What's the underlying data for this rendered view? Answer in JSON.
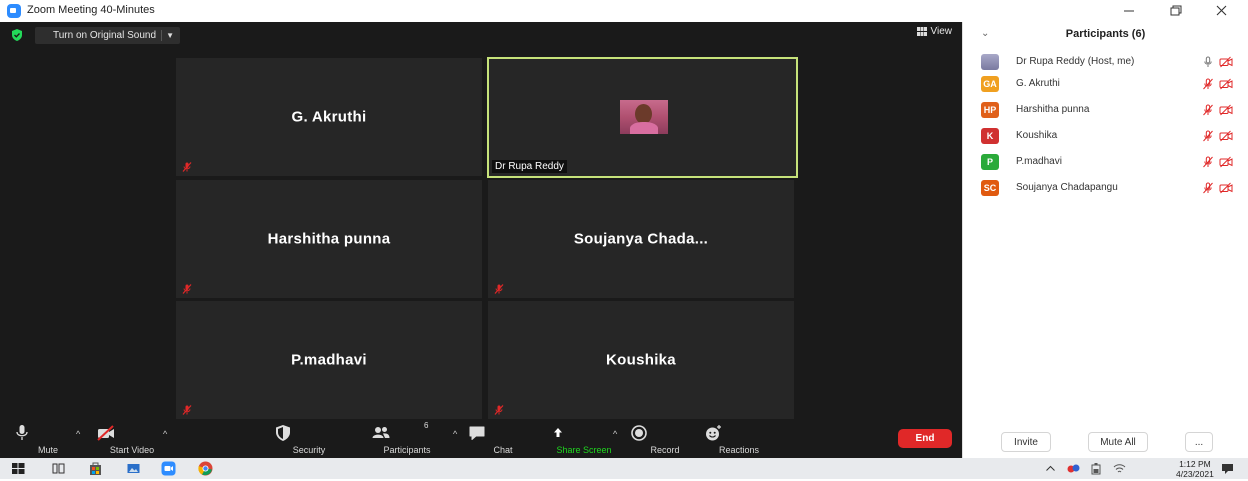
{
  "window": {
    "title": "Zoom Meeting 40-Minutes",
    "controls": [
      "minimize-icon",
      "restore-icon",
      "close-icon"
    ]
  },
  "meeting": {
    "original_sound_label": "Turn on Original Sound",
    "view_label": "View",
    "tiles": [
      {
        "name": "G. Akruthi",
        "muted": true
      },
      {
        "name": "Dr Rupa Reddy",
        "is_video": true,
        "active_speaker": true
      },
      {
        "name": "Harshitha punna",
        "muted": true
      },
      {
        "name": "Soujanya  Chada...",
        "muted": true
      },
      {
        "name": "P.madhavi",
        "muted": true
      },
      {
        "name": "Koushika",
        "muted": true
      }
    ]
  },
  "toolbar": {
    "mute": "Mute",
    "start_video": "Start Video",
    "security": "Security",
    "participants": "Participants",
    "participant_count": "6",
    "chat": "Chat",
    "share_screen": "Share Screen",
    "record": "Record",
    "reactions": "Reactions",
    "end": "End"
  },
  "panel": {
    "title": "Participants (6)",
    "participants": [
      {
        "name": "Dr Rupa Reddy (Host, me)",
        "avatar": "photo",
        "color": "#8a8ab0",
        "mic": "on",
        "video": "off"
      },
      {
        "name": "G. Akruthi",
        "avatar": "GA",
        "color": "#f0a020",
        "mic": "muted",
        "video": "off"
      },
      {
        "name": "Harshitha punna",
        "avatar": "HP",
        "color": "#e0601a",
        "mic": "muted",
        "video": "off"
      },
      {
        "name": "Koushika",
        "avatar": "K",
        "color": "#d03030",
        "mic": "muted",
        "video": "off"
      },
      {
        "name": "P.madhavi",
        "avatar": "P",
        "color": "#2aaa3a",
        "mic": "muted",
        "video": "off"
      },
      {
        "name": "Soujanya Chadapangu",
        "avatar": "SC",
        "color": "#e05a10",
        "mic": "muted",
        "video": "off"
      }
    ],
    "invite": "Invite",
    "mute_all": "Mute All",
    "more": "..."
  },
  "taskbar": {
    "time": "1:12 PM",
    "date": "4/23/2021"
  },
  "colors": {
    "meeting_bg": "#1a1a1a",
    "tile_bg": "#262626",
    "active_border": "#c6e27a",
    "share_green": "#1fb41f",
    "end_red": "#e02828",
    "muted_red": "#e02828"
  }
}
